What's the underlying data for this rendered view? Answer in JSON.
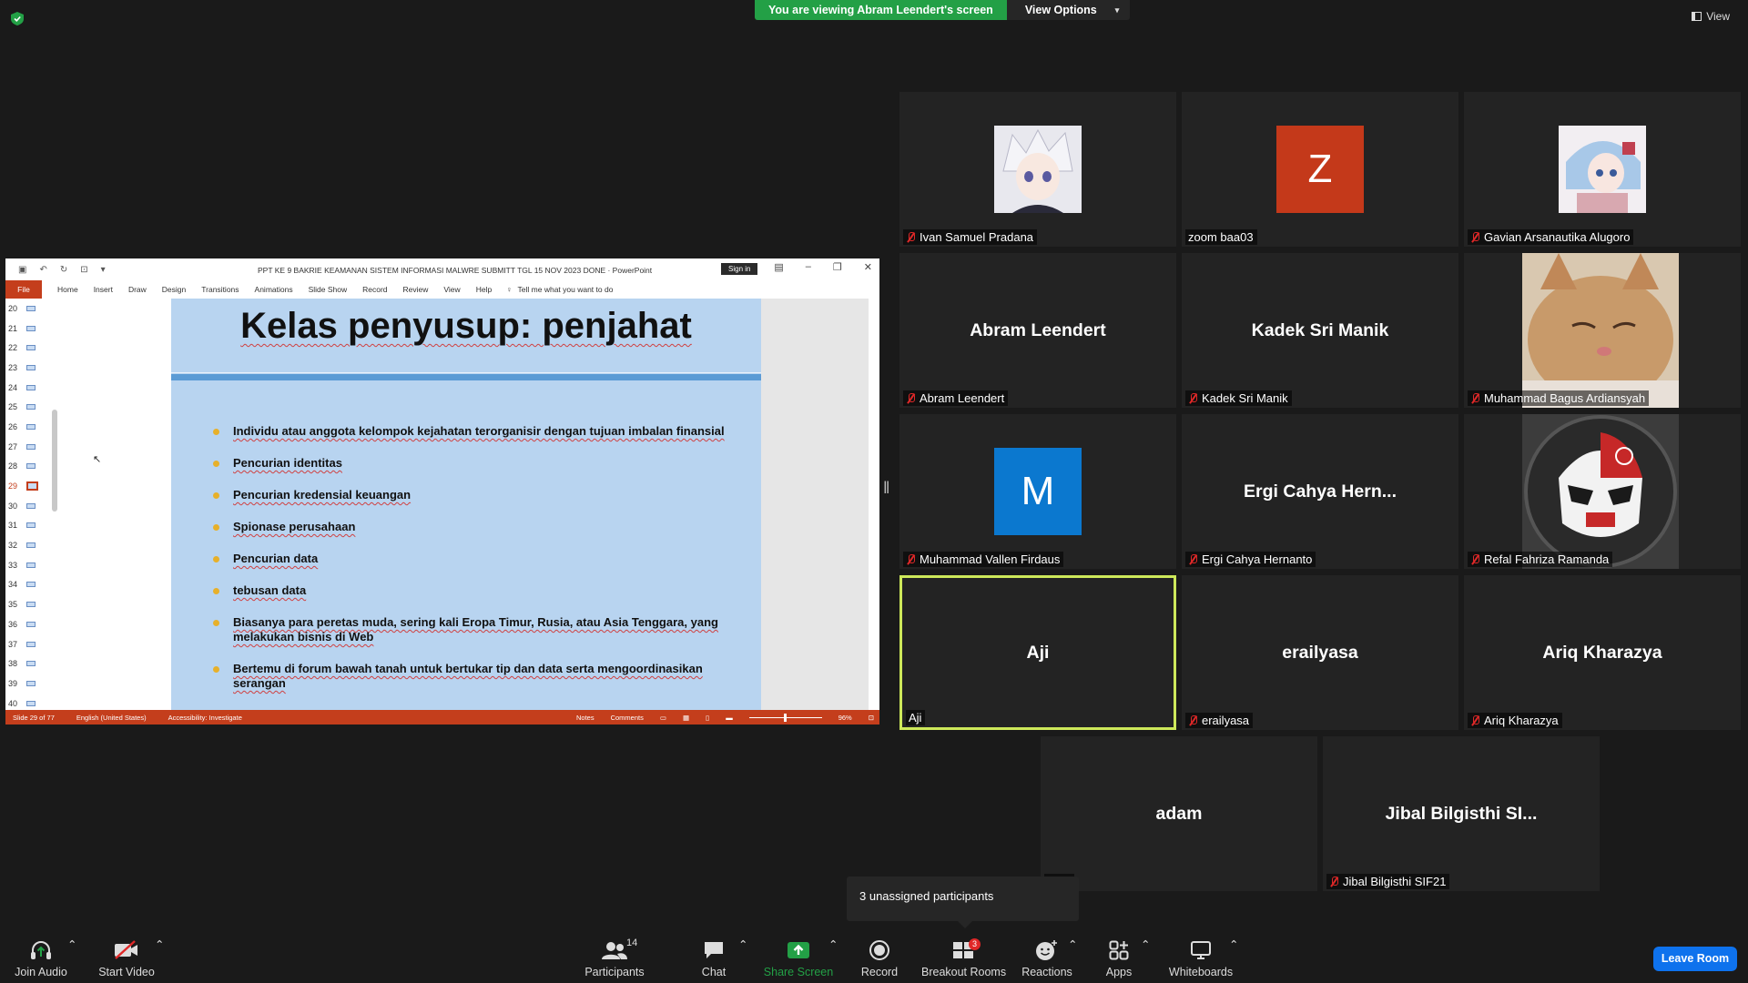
{
  "banner": {
    "viewing": "You are viewing Abram Leendert's screen",
    "view_options": "View Options"
  },
  "view_button": "View",
  "ppt": {
    "doc_title": "PPT KE 9 BAKRIE  KEAMANAN SISTEM INFORMASI  MALWRE SUBMITT TGL  15 NOV 2023 DONE  ·  PowerPoint",
    "sign_in": "Sign in",
    "menu": [
      "File",
      "Home",
      "Insert",
      "Draw",
      "Design",
      "Transitions",
      "Animations",
      "Slide Show",
      "Record",
      "Review",
      "View",
      "Help"
    ],
    "tell_me": "Tell me what you want to do",
    "thumb_numbers": [
      "20",
      "21",
      "22",
      "23",
      "24",
      "25",
      "26",
      "27",
      "28",
      "29",
      "30",
      "31",
      "32",
      "33",
      "34",
      "35",
      "36",
      "37",
      "38",
      "39",
      "40"
    ],
    "active_slide": "29",
    "slide_title": "Kelas penyusup: penjahat",
    "bullets": [
      "Individu atau anggota kelompok kejahatan terorganisir dengan tujuan imbalan finansial",
      "Pencurian identitas",
      "Pencurian kredensial keuangan",
      "Spionase perusahaan",
      "Pencurian data",
      "tebusan data",
      "Biasanya para peretas muda, sering kali Eropa Timur, Rusia, atau Asia Tenggara, yang melakukan bisnis di Web",
      "Bertemu di forum bawah tanah untuk bertukar tip dan data serta mengoordinasikan serangan"
    ],
    "status": {
      "slide_of": "Slide 29 of 77",
      "language": "English (United States)",
      "accessibility": "Accessibility: Investigate",
      "notes": "Notes",
      "comments": "Comments",
      "zoom": "96%"
    }
  },
  "tiles": [
    {
      "big": "",
      "name": "Ivan Samuel Pradana",
      "muted": true
    },
    {
      "big": "",
      "name": "zoom baa03",
      "muted": false,
      "initial": "Z",
      "color": "#c4391a"
    },
    {
      "big": "",
      "name": "Gavian Arsanautika Alugoro",
      "muted": true
    },
    {
      "big": "Abram Leendert",
      "name": "Abram Leendert",
      "muted": true
    },
    {
      "big": "Kadek Sri Manik",
      "name": "Kadek Sri Manik",
      "muted": true
    },
    {
      "big": "",
      "name": "Muhammad Bagus Ardiansyah",
      "muted": true
    },
    {
      "big": "",
      "name": "Muhammad Vallen Firdaus",
      "muted": true,
      "initial": "M",
      "color": "#0b78cf"
    },
    {
      "big": "Ergi Cahya Hern...",
      "name": "Ergi Cahya Hernanto",
      "muted": true
    },
    {
      "big": "",
      "name": "Refal Fahriza Ramanda",
      "muted": true
    },
    {
      "big": "Aji",
      "name": "Aji",
      "muted": false
    },
    {
      "big": "erailyasa",
      "name": "erailyasa",
      "muted": true
    },
    {
      "big": "Ariq Kharazya",
      "name": "Ariq Kharazya",
      "muted": true
    },
    {
      "big": "adam",
      "name": "m",
      "muted": true
    },
    {
      "big": "Jibal Bilgisthi SI...",
      "name": "Jibal Bilgisthi SIF21",
      "muted": true
    }
  ],
  "tooltip": "3 unassigned participants",
  "toolbar": {
    "join_audio": "Join Audio",
    "start_video": "Start Video",
    "participants": "Participants",
    "participants_count": "14",
    "chat": "Chat",
    "share_screen": "Share Screen",
    "record": "Record",
    "breakout_rooms": "Breakout Rooms",
    "breakout_badge": "3",
    "reactions": "Reactions",
    "apps": "Apps",
    "whiteboards": "Whiteboards",
    "leave_room": "Leave Room"
  },
  "colors": {
    "banner_green": "#23a046",
    "leave_blue": "#0e72ed",
    "ppt_red": "#c43e1c",
    "active_border": "#cde85a"
  }
}
